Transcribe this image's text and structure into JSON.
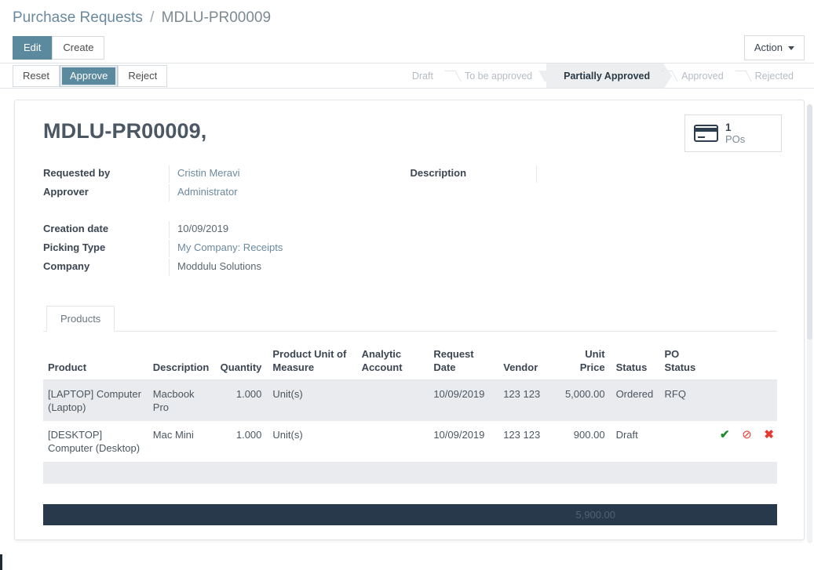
{
  "breadcrumb": {
    "root": "Purchase Requests",
    "separator": "/",
    "current": "MDLU-PR00009"
  },
  "control_panel": {
    "edit_label": "Edit",
    "create_label": "Create",
    "action_label": "Action"
  },
  "workflow_buttons": {
    "reset_label": "Reset",
    "approve_label": "Approve",
    "reject_label": "Reject"
  },
  "statusbar": {
    "steps": [
      {
        "label": "Draft",
        "active": false
      },
      {
        "label": "To be approved",
        "active": false
      },
      {
        "label": "Partially Approved",
        "active": true
      },
      {
        "label": "Approved",
        "active": false
      },
      {
        "label": "Rejected",
        "active": false
      }
    ]
  },
  "record": {
    "title": "MDLU-PR00009,"
  },
  "stat_button": {
    "icon": "credit-card-icon",
    "value": "1",
    "label": "POs"
  },
  "fields": {
    "left_group_1": [
      {
        "label": "Requested by",
        "value": "Cristin Meravi",
        "style": "link"
      },
      {
        "label": "Approver",
        "value": "Administrator",
        "style": "link"
      }
    ],
    "left_group_2": [
      {
        "label": "Creation date",
        "value": "10/09/2019",
        "style": "plain"
      },
      {
        "label": "Picking Type",
        "value": "My Company: Receipts",
        "style": "link"
      },
      {
        "label": "Company",
        "value": "Moddulu Solutions",
        "style": "plain"
      }
    ],
    "right_group": [
      {
        "label": "Description",
        "value": "",
        "style": "plain"
      }
    ]
  },
  "notebook": {
    "tabs": [
      {
        "label": "Products",
        "active": true
      }
    ]
  },
  "lines_table": {
    "headers": [
      "Product",
      "Description",
      "Quantity",
      "Product Unit of Measure",
      "Analytic Account",
      "Request Date",
      "Vendor",
      "Unit Price",
      "Status",
      "PO Status"
    ],
    "rows": [
      {
        "product": "[LAPTOP] Computer (Laptop)",
        "description": "Macbook Pro",
        "quantity": "1.000",
        "uom": "Unit(s)",
        "analytic_account": "",
        "request_date": "10/09/2019",
        "vendor": "123 123",
        "unit_price": "5,000.00",
        "status": "Ordered",
        "po_status": "RFQ",
        "highlighted": true,
        "show_actions": false
      },
      {
        "product": "[DESKTOP] Computer (Desktop)",
        "description": "Mac Mini",
        "quantity": "1.000",
        "uom": "Unit(s)",
        "analytic_account": "",
        "request_date": "10/09/2019",
        "vendor": "123 123",
        "unit_price": "900.00",
        "status": "Draft",
        "po_status": "",
        "highlighted": false,
        "show_actions": true
      }
    ],
    "row_actions": {
      "approve_icon": "✔",
      "reject_icon": "⊘",
      "delete_icon": "✖"
    },
    "total": "5,900.00"
  },
  "colors": {
    "primary": "#5b899e",
    "link": "#6a899f",
    "total_bar": "#27394a",
    "row_highlight": "#e9ebee",
    "approve_green": "#1e8c2e",
    "danger_red": "#e8392f"
  }
}
